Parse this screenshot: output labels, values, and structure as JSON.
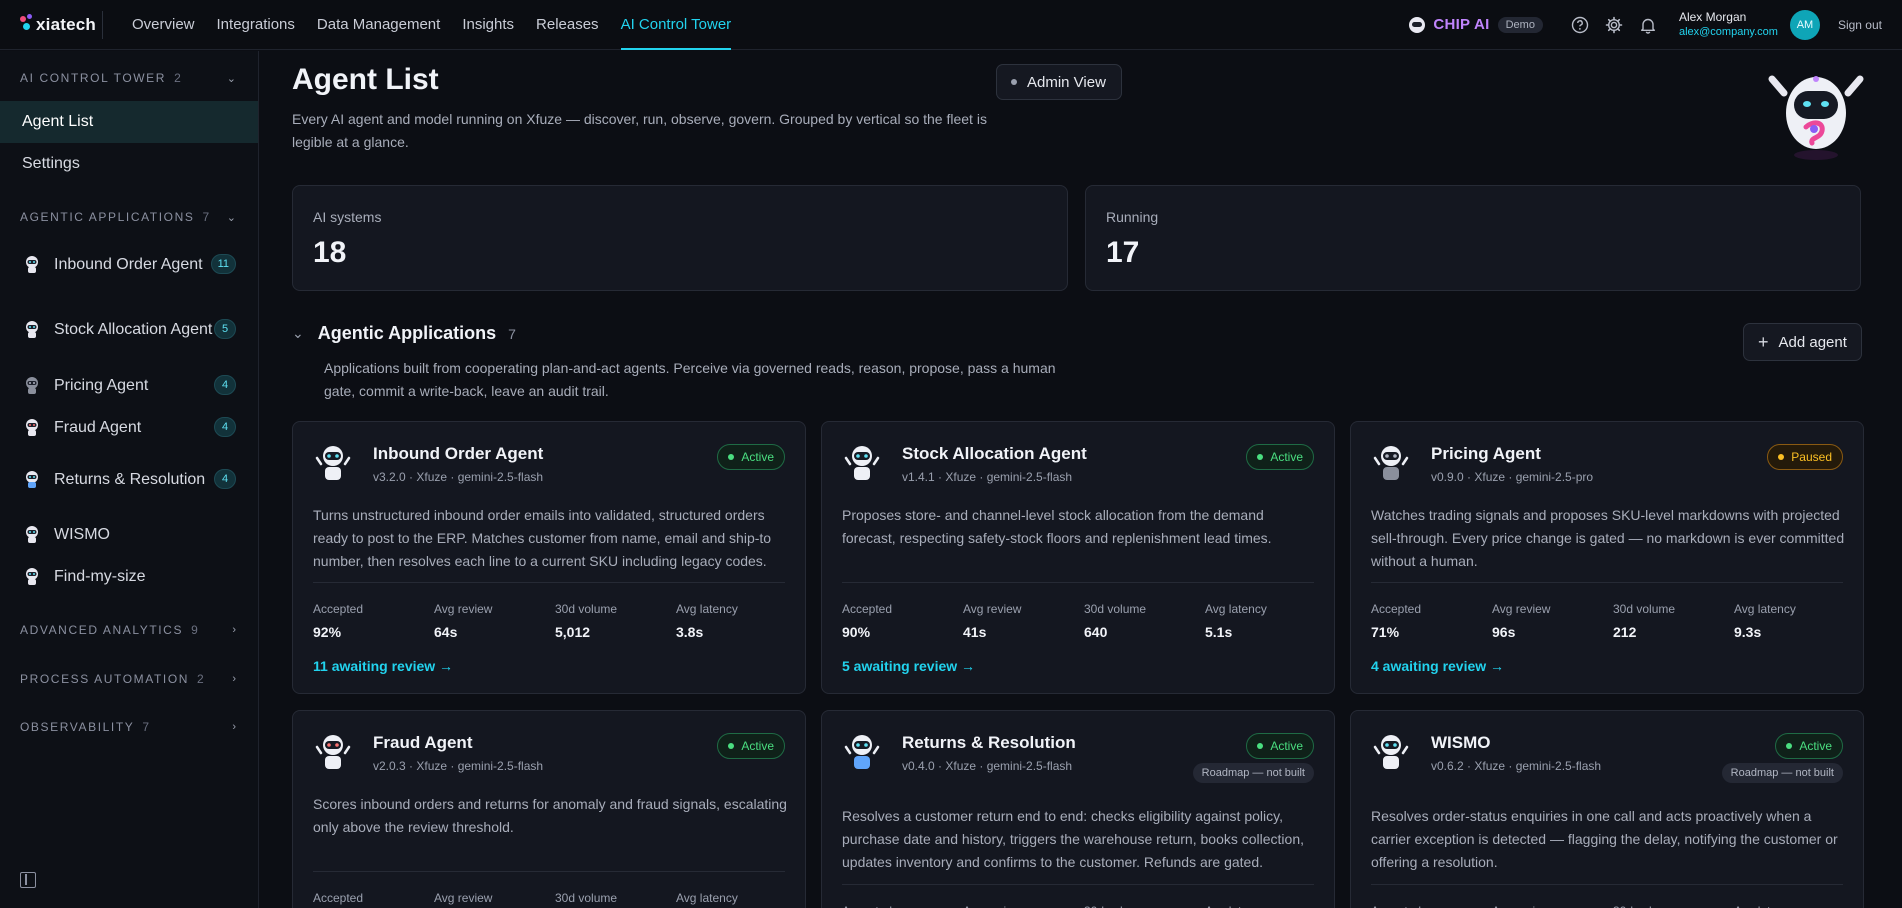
{
  "brand": {
    "name": "xiatech"
  },
  "nav": {
    "links": [
      "Overview",
      "Integrations",
      "Data Management",
      "Insights",
      "Releases",
      "AI Control Tower"
    ],
    "active": "AI Control Tower"
  },
  "topbar": {
    "chip_label": "CHIP AI",
    "demo_badge": "Demo",
    "user_name": "Alex Morgan",
    "user_email": "alex@company.com",
    "avatar_initials": "AM",
    "signout": "Sign out"
  },
  "sidebar": {
    "control_tower": {
      "title": "AI CONTROL TOWER",
      "count": "2",
      "items": [
        "Agent List",
        "Settings"
      ]
    },
    "agentic": {
      "title": "AGENTIC APPLICATIONS",
      "count": "7",
      "items": [
        {
          "label": "Inbound Order Agent",
          "badge": "11"
        },
        {
          "label": "Stock Allocation Agent",
          "badge": "5"
        },
        {
          "label": "Pricing Agent",
          "badge": "4"
        },
        {
          "label": "Fraud Agent",
          "badge": "4"
        },
        {
          "label": "Returns & Resolution",
          "badge": "4"
        },
        {
          "label": "WISMO",
          "badge": ""
        },
        {
          "label": "Find-my-size",
          "badge": ""
        }
      ]
    },
    "collapsed_sections": [
      {
        "title": "ADVANCED ANALYTICS",
        "count": "9"
      },
      {
        "title": "PROCESS AUTOMATION",
        "count": "2"
      },
      {
        "title": "OBSERVABILITY",
        "count": "7"
      }
    ]
  },
  "page": {
    "title": "Agent List",
    "description": "Every AI agent and model running on Xfuze — discover, run, observe, govern. Grouped by vertical so the fleet is legible at a glance.",
    "admin_view": "Admin View"
  },
  "stats": [
    {
      "label": "AI systems",
      "value": "18"
    },
    {
      "label": "Running",
      "value": "17"
    }
  ],
  "group": {
    "title": "Agentic Applications",
    "count": "7",
    "description": "Applications built from cooperating plan-and-act agents. Perceive via governed reads, reason, propose, pass a human gate, commit a write-back, leave an audit trail.",
    "add_agent": "Add agent"
  },
  "metric_labels": [
    "Accepted",
    "Avg review",
    "30d volume",
    "Avg latency"
  ],
  "cards": [
    {
      "name": "Inbound Order Agent",
      "meta": "v3.2.0 · Xfuze · gemini-2.5-flash",
      "status": "Active",
      "roadmap": "",
      "description": "Turns unstructured inbound order emails into validated, structured orders ready to post to the ERP. Matches customer from name, email and ship-to number, then resolves each line to a current SKU including legacy codes.",
      "metrics": [
        "92%",
        "64s",
        "5,012",
        "3.8s"
      ],
      "review": "11 awaiting review →"
    },
    {
      "name": "Stock Allocation Agent",
      "meta": "v1.4.1 · Xfuze · gemini-2.5-flash",
      "status": "Active",
      "roadmap": "",
      "description": "Proposes store- and channel-level stock allocation from the demand forecast, respecting safety-stock floors and replenishment lead times.",
      "metrics": [
        "90%",
        "41s",
        "640",
        "5.1s"
      ],
      "review": "5 awaiting review →"
    },
    {
      "name": "Pricing Agent",
      "meta": "v0.9.0 · Xfuze · gemini-2.5-pro",
      "status": "Paused",
      "roadmap": "",
      "description": "Watches trading signals and proposes SKU-level markdowns with projected sell-through. Every price change is gated — no markdown is ever committed without a human.",
      "metrics": [
        "71%",
        "96s",
        "212",
        "9.3s"
      ],
      "review": "4 awaiting review →"
    },
    {
      "name": "Fraud Agent",
      "meta": "v2.0.3 · Xfuze · gemini-2.5-flash",
      "status": "Active",
      "roadmap": "",
      "description": "Scores inbound orders and returns for anomaly and fraud signals, escalating only above the review threshold.",
      "metrics": [
        "",
        "",
        "",
        ""
      ],
      "review": ""
    },
    {
      "name": "Returns & Resolution",
      "meta": "v0.4.0 · Xfuze · gemini-2.5-flash",
      "status": "Active",
      "roadmap": "Roadmap — not built",
      "description": "Resolves a customer return end to end: checks eligibility against policy, purchase date and history, triggers the warehouse return, books collection, updates inventory and confirms to the customer. Refunds are gated.",
      "metrics": [
        "",
        "",
        "",
        ""
      ],
      "review": ""
    },
    {
      "name": "WISMO",
      "meta": "v0.6.2 · Xfuze · gemini-2.5-flash",
      "status": "Active",
      "roadmap": "Roadmap — not built",
      "description": "Resolves order-status enquiries in one call and acts proactively when a carrier exception is detected — flagging the delay, notifying the customer or offering a resolution.",
      "metrics": [
        "",
        "",
        "",
        ""
      ],
      "review": ""
    }
  ],
  "colors": {
    "accent": "#22d3ee",
    "active": "#4ade80",
    "paused": "#fbbf24",
    "chip": "#c084fc"
  }
}
